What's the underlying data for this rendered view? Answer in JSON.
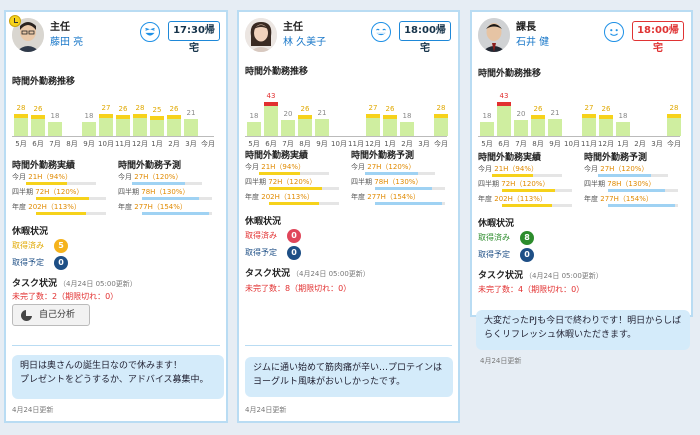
{
  "texts": {
    "chart_title": "時間外勤務推移",
    "actual_title": "時間外勤務実績",
    "forecast_title": "時間外勤務予測",
    "leave_title": "休暇状況",
    "leave_taken": "取得済み",
    "leave_planned": "取得予定",
    "task_title": "タスク状況",
    "self_analysis": "自己分析"
  },
  "months": [
    "5月",
    "6月",
    "7月",
    "8月",
    "9月",
    "10月",
    "11月",
    "12月",
    "1月",
    "2月",
    "3月",
    "今月"
  ],
  "colors": {
    "accent": "#1e88d8",
    "bar": "#cfeea0",
    "warn_yellow": "#f6d21b",
    "warn_red": "#e23030",
    "leave_green": "#2c8c2c",
    "leave_navy": "#1e4f86"
  },
  "members": [
    {
      "role": "主任",
      "name": "藤田 亮",
      "mood_icon": "laughing-face-icon",
      "go_home": "17:30帰宅",
      "overtime": [
        {
          "value": 28,
          "label": "28",
          "level": "yellow"
        },
        {
          "value": 26,
          "label": "26",
          "level": "yellow"
        },
        {
          "value": 18,
          "label": "18",
          "level": "green"
        },
        {
          "value": 0,
          "label": "",
          "level": "none"
        },
        {
          "value": 18,
          "label": "18",
          "level": "green"
        },
        {
          "value": 27,
          "label": "27",
          "level": "yellow"
        },
        {
          "value": 26,
          "label": "26",
          "level": "yellow"
        },
        {
          "value": 28,
          "label": "28",
          "level": "yellow"
        },
        {
          "value": 25,
          "label": "25",
          "level": "yellow"
        },
        {
          "value": 26,
          "label": "26",
          "level": "yellow"
        },
        {
          "value": 21,
          "label": "21",
          "level": "green"
        },
        {
          "value": 0,
          "label": "",
          "level": "none"
        }
      ],
      "actual": [
        {
          "label": "今月",
          "hours": "21H",
          "pct": "（94%）",
          "ratio": 0.94
        },
        {
          "label": "四半期",
          "hours": "72H",
          "pct": "（120%）",
          "ratio": 1.2
        },
        {
          "label": "年度",
          "hours": "202H",
          "pct": "（113%）",
          "ratio": 1.13
        }
      ],
      "forecast": [
        {
          "label": "今月",
          "hours": "27H",
          "pct": "（120%）",
          "ratio": 1.2
        },
        {
          "label": "四半期",
          "hours": "78H",
          "pct": "（130%）",
          "ratio": 1.3
        },
        {
          "label": "年度",
          "hours": "277H",
          "pct": "（154%）",
          "ratio": 1.54
        }
      ],
      "leave_taken": "5",
      "leave_taken_color": "#f5b31c",
      "leave_planned": "0",
      "task_time": "（4月24日 05:00更新）",
      "task_status": "未完了数：2（期限切れ：0）",
      "message": [
        "明日は奥さんの誕生日なので休みます！",
        "プレゼントをどうするか、アドバイス募集中。"
      ],
      "updated": "4月24日更新"
    },
    {
      "role": "主任",
      "name": "林 久美子",
      "mood_icon": "grinning-face-icon",
      "go_home": "18:00帰宅",
      "overtime": [
        {
          "value": 18,
          "label": "18",
          "level": "green"
        },
        {
          "value": 43,
          "label": "43",
          "level": "red"
        },
        {
          "value": 20,
          "label": "20",
          "level": "green"
        },
        {
          "value": 26,
          "label": "26",
          "level": "yellow"
        },
        {
          "value": 21,
          "label": "21",
          "level": "green"
        },
        {
          "value": 0,
          "label": "",
          "level": "none"
        },
        {
          "value": 0,
          "label": "",
          "level": "none"
        },
        {
          "value": 27,
          "label": "27",
          "level": "yellow"
        },
        {
          "value": 26,
          "label": "26",
          "level": "yellow"
        },
        {
          "value": 18,
          "label": "18",
          "level": "green"
        },
        {
          "value": 0,
          "label": "",
          "level": "none"
        },
        {
          "value": 28,
          "label": "28",
          "level": "yellow"
        }
      ],
      "actual": [
        {
          "label": "今月",
          "hours": "21H",
          "pct": "（94%）",
          "ratio": 0.94
        },
        {
          "label": "四半期",
          "hours": "72H",
          "pct": "（120%）",
          "ratio": 1.2
        },
        {
          "label": "年度",
          "hours": "202H",
          "pct": "（113%）",
          "ratio": 1.13
        }
      ],
      "forecast": [
        {
          "label": "今月",
          "hours": "27H",
          "pct": "（120%）",
          "ratio": 1.2
        },
        {
          "label": "四半期",
          "hours": "78H",
          "pct": "（130%）",
          "ratio": 1.3
        },
        {
          "label": "年度",
          "hours": "277H",
          "pct": "（154%）",
          "ratio": 1.54
        }
      ],
      "leave_taken": "0",
      "leave_taken_color": "#e0465a",
      "leave_planned": "0",
      "task_time": "（4月24日 05:00更新）",
      "task_status": "未完了数：8（期限切れ：0）",
      "message": [
        "ジムに通い始めて筋肉痛が辛い…プロテインは",
        "ヨーグルト風味がおいしかったです。"
      ],
      "updated": "4月24日更新"
    },
    {
      "role": "課長",
      "name": "石井 健",
      "mood_icon": "smiling-face-icon",
      "go_home": "18:00帰宅",
      "overtime": [
        {
          "value": 18,
          "label": "18",
          "level": "green"
        },
        {
          "value": 43,
          "label": "43",
          "level": "red"
        },
        {
          "value": 20,
          "label": "20",
          "level": "green"
        },
        {
          "value": 26,
          "label": "26",
          "level": "yellow"
        },
        {
          "value": 21,
          "label": "21",
          "level": "green"
        },
        {
          "value": 0,
          "label": "",
          "level": "none"
        },
        {
          "value": 27,
          "label": "27",
          "level": "yellow"
        },
        {
          "value": 26,
          "label": "26",
          "level": "yellow"
        },
        {
          "value": 18,
          "label": "18",
          "level": "green"
        },
        {
          "value": 0,
          "label": "",
          "level": "none"
        },
        {
          "value": 0,
          "label": "",
          "level": "none"
        },
        {
          "value": 28,
          "label": "28",
          "level": "yellow"
        }
      ],
      "actual": [
        {
          "label": "今月",
          "hours": "21H",
          "pct": "（94%）",
          "ratio": 0.94
        },
        {
          "label": "四半期",
          "hours": "72H",
          "pct": "（120%）",
          "ratio": 1.2
        },
        {
          "label": "年度",
          "hours": "202H",
          "pct": "（113%）",
          "ratio": 1.13
        }
      ],
      "forecast": [
        {
          "label": "今月",
          "hours": "27H",
          "pct": "（120%）",
          "ratio": 1.2
        },
        {
          "label": "四半期",
          "hours": "78H",
          "pct": "（130%）",
          "ratio": 1.3
        },
        {
          "label": "年度",
          "hours": "277H",
          "pct": "（154%）",
          "ratio": 1.54
        }
      ],
      "leave_taken": "8",
      "leave_taken_color": "#2c8c2c",
      "leave_planned": "0",
      "task_time": "（4月24日 05:00更新）",
      "task_status": "未完了数：4（期限切れ：0）",
      "message": [
        "大変だったPJも今日で終わりです！明日からしば",
        "らくリフレッシュ休暇いただきます。"
      ],
      "updated": "4月24日更新"
    }
  ]
}
